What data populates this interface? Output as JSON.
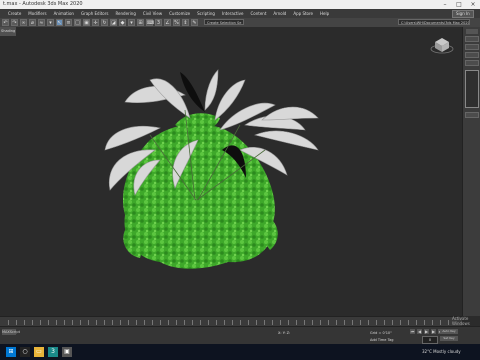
{
  "window": {
    "title": "t.max - Autodesk 3ds Max 2020"
  },
  "menus": [
    "Create",
    "Modifiers",
    "Animation",
    "Graph Editors",
    "Rendering",
    "Civil View",
    "Customize",
    "Scripting",
    "Interactive",
    "Content",
    "Arnold",
    "App Store",
    "Help"
  ],
  "signin_label": "Sign In",
  "toolbar": {
    "selection_set": "Create Selection Se",
    "workspace": "C:\\Users\\WH\\Documents\\3ds Max 2020"
  },
  "viewport": {
    "left_tab": "Shading",
    "label": ""
  },
  "timeline": {},
  "status": {
    "max_script": "MAXScript",
    "coords": "X:  Y:  Z:",
    "grid": "Grid = 0'10\"",
    "add_time_tag": "Add Time Tag",
    "frame": "0",
    "auto_key": "Auto Key",
    "set_key": "Set Key",
    "activate": "Activate Windows"
  },
  "taskbar": {
    "weather": "32°C  Mostly cloudy"
  },
  "colors": {
    "foliage": "#3ea82a",
    "fronds": "#d8d8d8",
    "viewport_bg": "#2b2b2b"
  }
}
